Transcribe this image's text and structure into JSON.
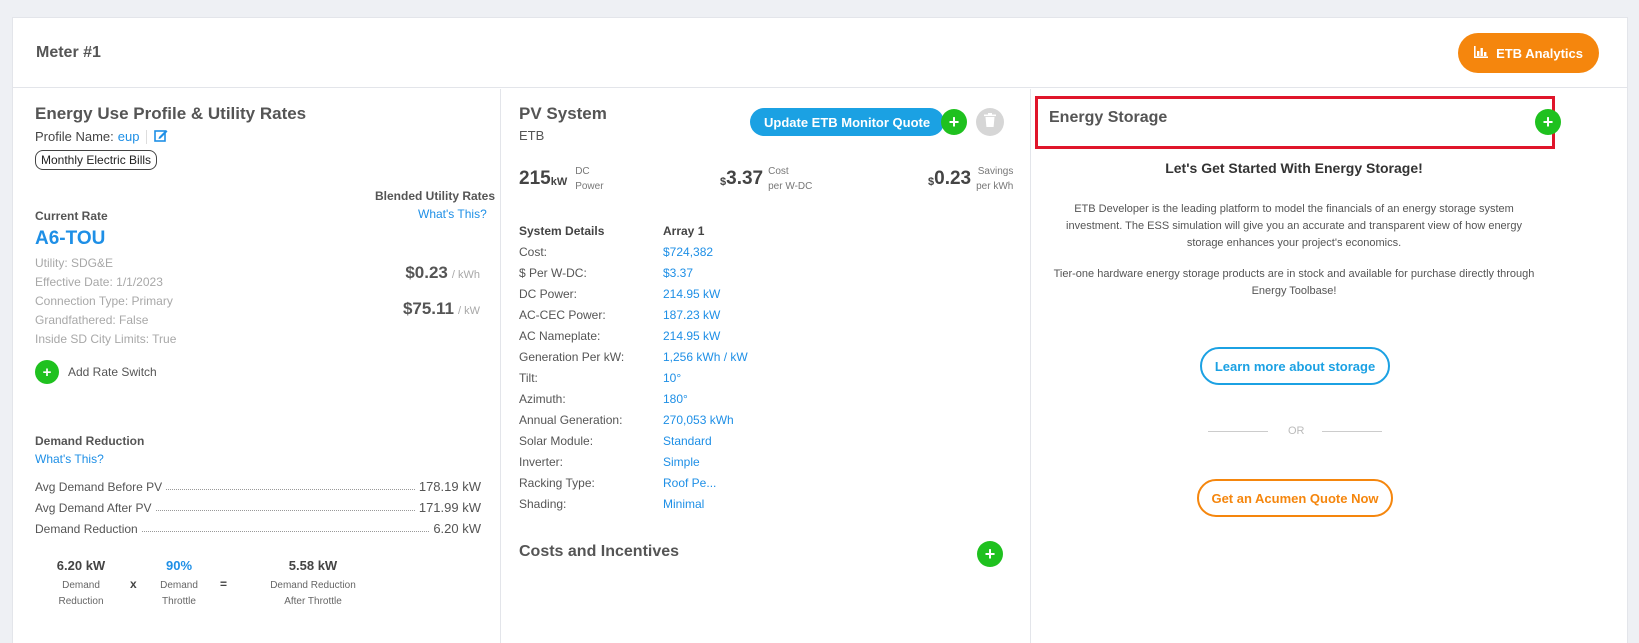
{
  "header": {
    "title": "Meter #1",
    "analytics_label": "ETB Analytics"
  },
  "energy_use": {
    "title": "Energy Use Profile & Utility Rates",
    "profile_label": "Profile Name:",
    "profile_value": "eup",
    "tag": "Monthly Electric Bills",
    "blended_label": "Blended Utility Rates",
    "whats_this": "What's This?",
    "current_rate_label": "Current Rate",
    "rate_name": "A6-TOU",
    "details": [
      "Utility: SDG&E",
      "Effective Date: 1/1/2023",
      "Connection Type: Primary",
      "Grandfathered: False",
      "Inside SD City Limits: True"
    ],
    "energy_rate": "$0.23",
    "energy_unit": "/ kWh",
    "demand_rate": "$75.11",
    "demand_unit": "/ kW",
    "add_rate_switch": "Add Rate Switch"
  },
  "demand_reduction": {
    "title": "Demand Reduction",
    "whats_this": "What's This?",
    "rows": [
      {
        "label": "Avg Demand Before PV",
        "value": "178.19 kW"
      },
      {
        "label": "Avg Demand After PV",
        "value": "171.99 kW"
      },
      {
        "label": "Demand Reduction",
        "value": "6.20 kW"
      }
    ],
    "calc": {
      "a_value": "6.20 kW",
      "a_label1": "Demand",
      "a_label2": "Reduction",
      "op1": "x",
      "b_value": "90%",
      "b_label1": "Demand",
      "b_label2": "Throttle",
      "op2": "=",
      "c_value": "5.58 kW",
      "c_label1": "Demand Reduction",
      "c_label2": "After Throttle"
    }
  },
  "pv": {
    "title": "PV System",
    "subtitle": "ETB",
    "update_btn": "Update ETB Monitor Quote",
    "power_value": "215",
    "power_unit": "kW",
    "power_label1": "DC",
    "power_label2": "Power",
    "cost_prefix": "$",
    "cost_value": "3.37",
    "cost_label1": "Cost",
    "cost_label2": "per W-DC",
    "savings_prefix": "$",
    "savings_value": "0.23",
    "savings_label1": "Savings",
    "savings_label2": "per kWh",
    "details_header": "System Details",
    "array_header": "Array 1",
    "details": [
      {
        "label": "Cost:",
        "value": "$724,382"
      },
      {
        "label": "$ Per W-DC:",
        "value": "$3.37"
      },
      {
        "label": "DC Power:",
        "value": "214.95 kW"
      },
      {
        "label": "AC-CEC Power:",
        "value": "187.23 kW"
      },
      {
        "label": "AC Nameplate:",
        "value": "214.95 kW"
      },
      {
        "label": "Generation Per kW:",
        "value": "1,256 kWh / kW"
      },
      {
        "label": "Tilt:",
        "value": "10°"
      },
      {
        "label": "Azimuth:",
        "value": "180°"
      },
      {
        "label": "Annual Generation:",
        "value": "270,053 kWh"
      },
      {
        "label": "Solar Module:",
        "value": "Standard"
      },
      {
        "label": "Inverter:",
        "value": "Simple"
      },
      {
        "label": "Racking Type:",
        "value": "Roof Pe..."
      },
      {
        "label": "Shading:",
        "value": "Minimal"
      }
    ],
    "costs_title": "Costs and Incentives"
  },
  "storage": {
    "title": "Energy Storage",
    "headline": "Let's Get Started With Energy Storage!",
    "para1": "ETB Developer is the leading platform to model the financials of an energy storage system investment. The ESS simulation will give you an accurate and transparent view of how energy storage enhances your project's economics.",
    "para2": "Tier-one hardware energy storage products are in stock and available for purchase directly through Energy Toolbase!",
    "learn_btn": "Learn more about storage",
    "or_text": "OR",
    "quote_btn": "Get an Acumen Quote Now"
  },
  "colors": {
    "accent_orange": "#f5860d",
    "accent_blue": "#1ba1e3",
    "link_blue": "#1e8fe6",
    "add_green": "#1fc11f",
    "highlight_red": "#e0152a"
  }
}
